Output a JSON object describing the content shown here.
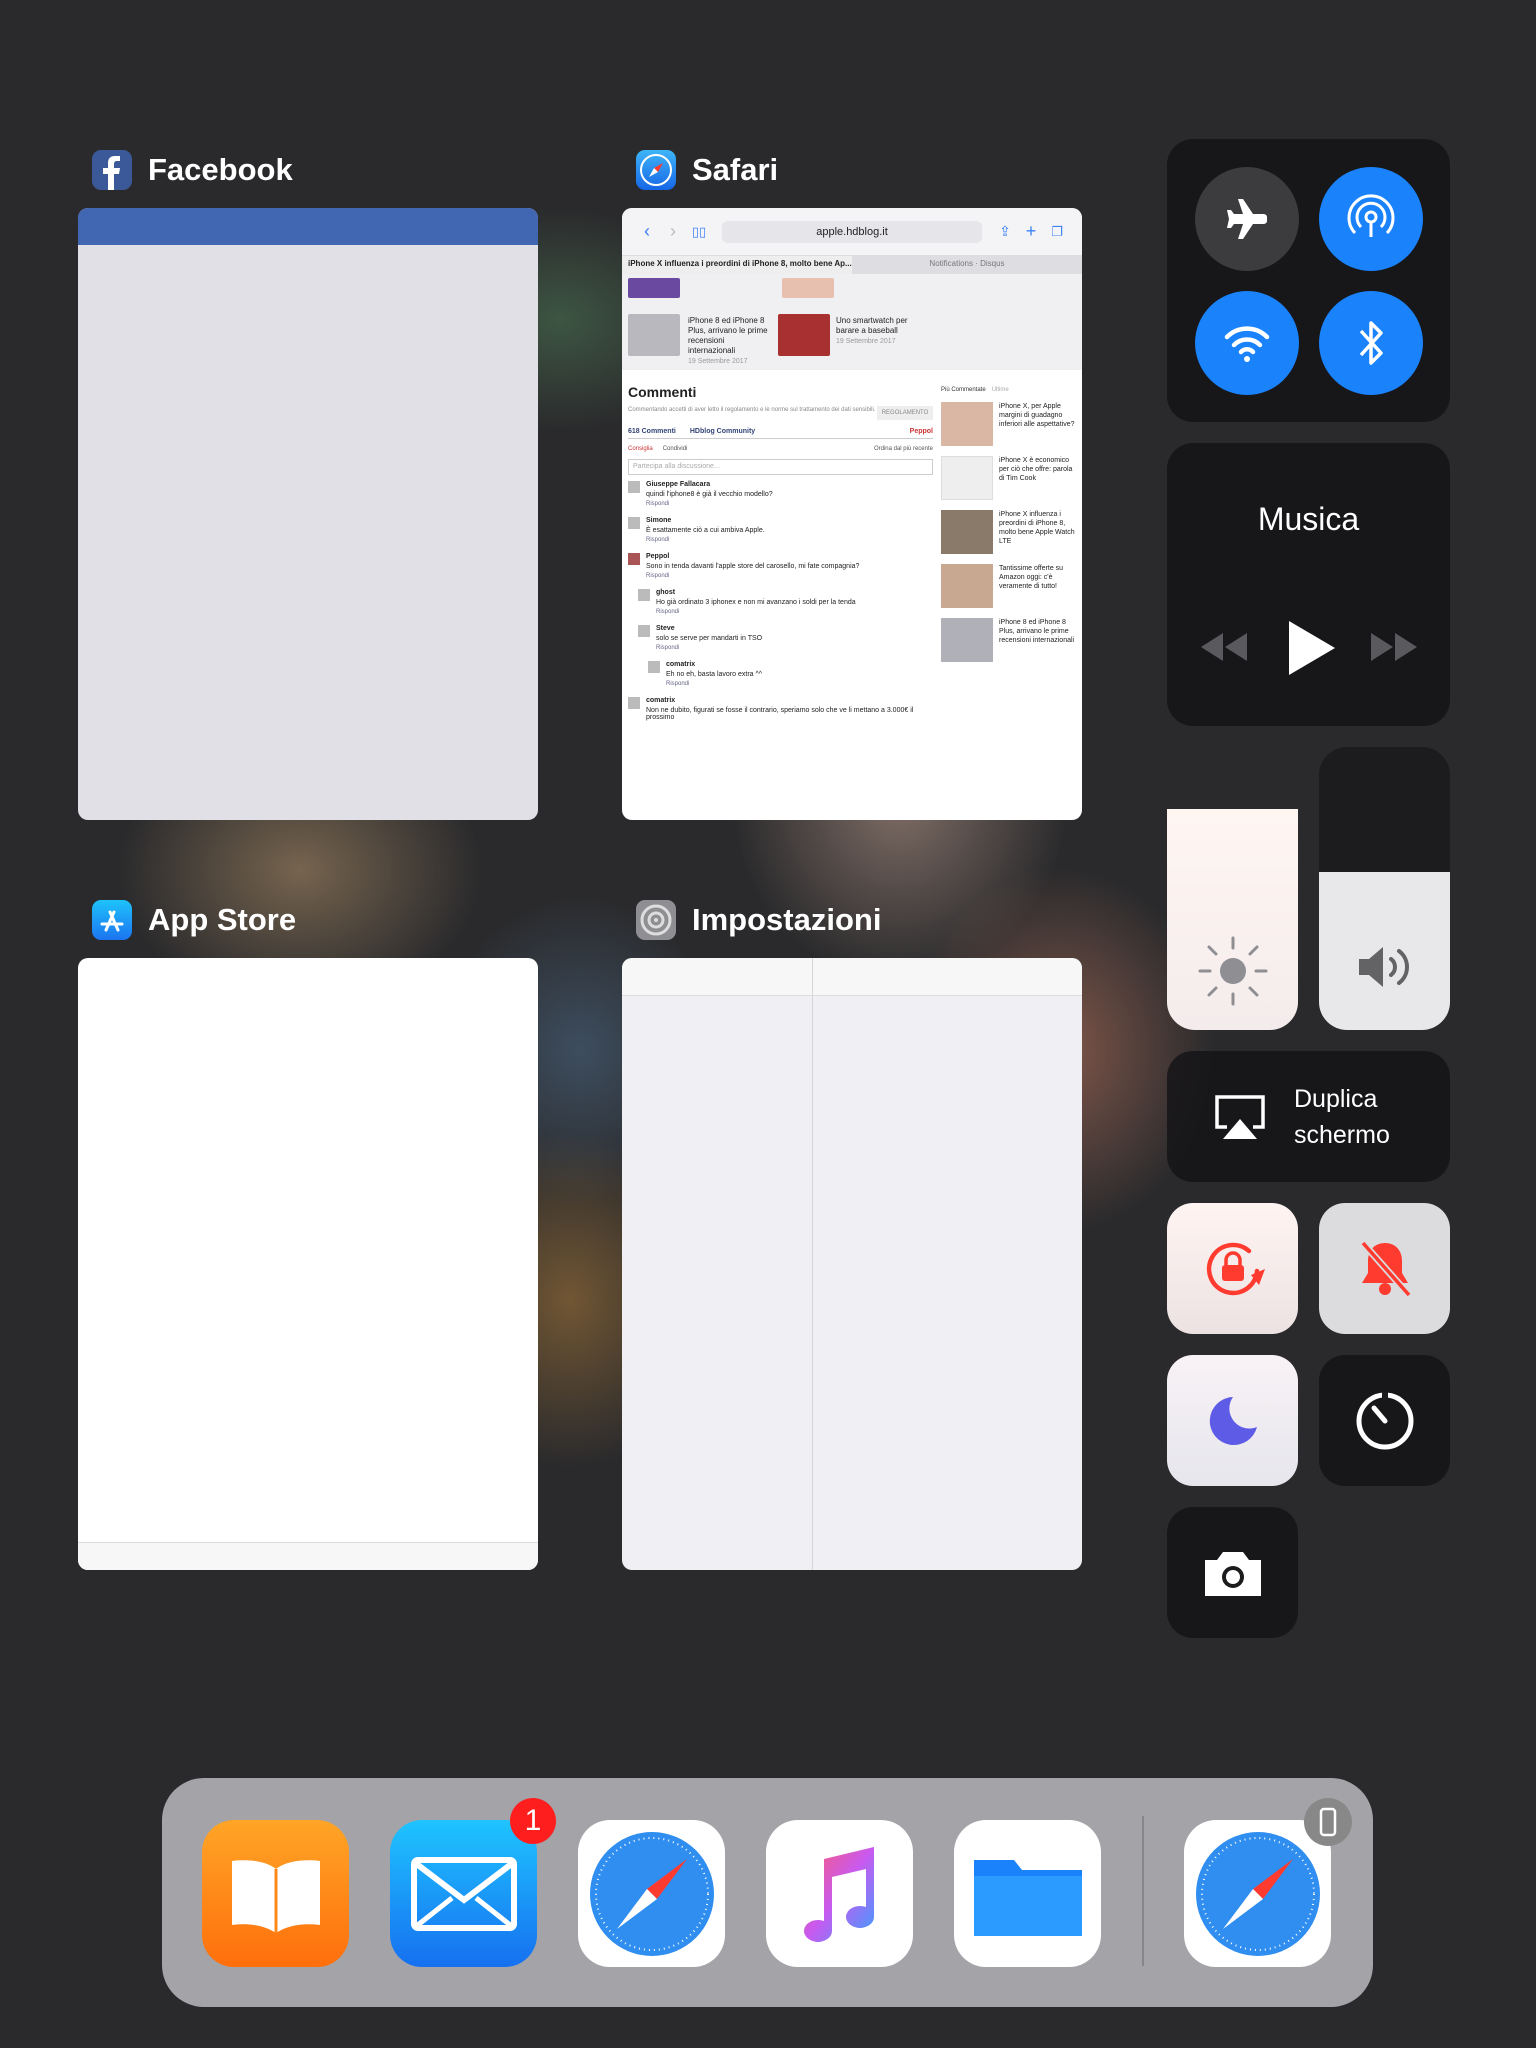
{
  "apps": [
    {
      "name": "Facebook",
      "icon": "facebook-icon"
    },
    {
      "name": "Safari",
      "icon": "safari-icon"
    },
    {
      "name": "App Store",
      "icon": "app-store-icon"
    },
    {
      "name": "Impostazioni",
      "icon": "settings-icon"
    }
  ],
  "safari_preview": {
    "url": "apple.hdblog.it",
    "active_tab": "iPhone X influenza i preordini di iPhone 8, molto bene Ap...",
    "other_tab": "Notifications · Disqus",
    "top_articles": [
      {
        "title": "iPhone 8 ed iPhone 8 Plus, arrivano le prime recensioni internazionali",
        "date": "19 Settembre 2017"
      },
      {
        "title": "Uno smartwatch per barare a baseball",
        "date": "19 Settembre 2017"
      }
    ],
    "comments_title": "Commenti",
    "comments_note": "Commentando accetti di aver letto il regolamento e le norme sul trattamento dei dati sensibili.",
    "regolamento": "REGOLAMENTO",
    "tabs": [
      "618 Commenti",
      "HDblog Community"
    ],
    "user": "Peppol",
    "consiglia": "Consiglia",
    "condividi": "Condividi",
    "order": "Ordina dal più recente",
    "input_placeholder": "Partecipa alla discussione...",
    "comments": [
      {
        "name": "Giuseppe Fallacara",
        "text": "quindi l'iphone8 è già il vecchio modello?"
      },
      {
        "name": "Simone",
        "text": "È esattamente ciò a cui ambiva Apple."
      },
      {
        "name": "Peppol",
        "text": "Sono in tenda davanti l'apple store del carosello, mi fate compagnia?"
      },
      {
        "name": "ghost",
        "text": "Ho già ordinato 3 iphonex e non mi avanzano i soldi per la tenda"
      },
      {
        "name": "Steve",
        "text": "solo se serve per mandarti in TSO"
      },
      {
        "name": "comatrix",
        "text": "Eh no eh, basta lavoro extra ^^"
      },
      {
        "name": "comatrix",
        "text": "Non ne dubito, figurati se fosse il contrario, speriamo solo che ve li mettano a 3.000€ il prossimo"
      }
    ],
    "reply": "Rispondi",
    "side_tabs": [
      "Più Commentate",
      "Ultime"
    ],
    "side_articles": [
      "iPhone X, per Apple margini di guadagno inferiori alle aspettative?",
      "iPhone X è economico per ciò che offre: parola di Tim Cook",
      "iPhone X influenza i preordini di iPhone 8, molto bene Apple Watch LTE",
      "Tantissime offerte su Amazon oggi: c'è veramente di tutto!",
      "iPhone 8 ed iPhone 8 Plus, arrivano le prime recensioni internazionali"
    ]
  },
  "control_center": {
    "connectivity": [
      {
        "name": "airplane-mode",
        "state": "off"
      },
      {
        "name": "airdrop",
        "state": "on"
      },
      {
        "name": "wifi",
        "state": "on"
      },
      {
        "name": "bluetooth",
        "state": "on"
      }
    ],
    "music_label": "Musica",
    "brightness_level": 0.78,
    "volume_level": 0.56,
    "mirror_label_1": "Duplica",
    "mirror_label_2": "schermo",
    "colors": {
      "accent_blue": "#1a82fb",
      "red": "#ff3b30",
      "purple": "#5e5ce6"
    }
  },
  "dock": {
    "apps": [
      "iBooks",
      "Mail",
      "Safari",
      "Musica",
      "File"
    ],
    "recent": [
      "Safari"
    ],
    "mail_badge": "1"
  }
}
